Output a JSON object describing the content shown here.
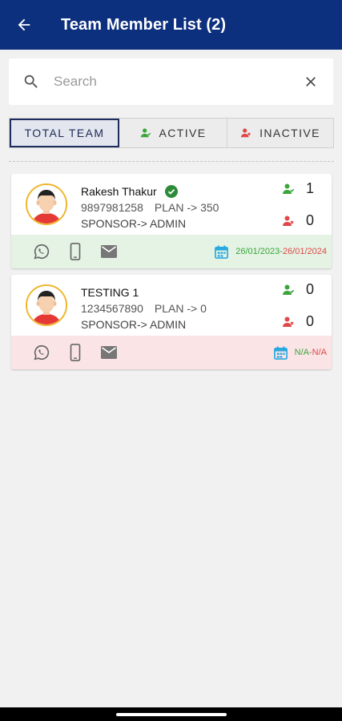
{
  "appbar": {
    "title": "Team Member List  (2)",
    "back_icon": "arrow-left-icon",
    "background": "#0c2f7e"
  },
  "search": {
    "placeholder": "Search",
    "value": ""
  },
  "tabs": [
    {
      "label": "TOTAL TEAM",
      "selected": true
    },
    {
      "label": "ACTIVE",
      "icon": "active-user-icon",
      "color": "#3aa53a"
    },
    {
      "label": "INACTIVE",
      "icon": "inactive-user-icon",
      "color": "#e04848"
    }
  ],
  "members": [
    {
      "name": "Rakesh Thakur",
      "verified": true,
      "phone": "9897981258",
      "plan": "PLAN -> 350",
      "sponsor": "SPONSOR-> ADMIN",
      "active_count": "1",
      "inactive_count": "0",
      "date_start": "26/01/2023",
      "date_sep": " - ",
      "date_end": "26/01/2024",
      "status": "active"
    },
    {
      "name": "TESTING 1",
      "verified": false,
      "phone": "1234567890",
      "plan": "PLAN -> 0",
      "sponsor": "SPONSOR-> ADMIN",
      "active_count": "0",
      "inactive_count": "0",
      "date_start": "N/A",
      "date_sep": " - ",
      "date_end": "N/A",
      "status": "inactive"
    }
  ],
  "colors": {
    "active": "#3aa53a",
    "inactive": "#e04848",
    "active_bg": "#e4f3e4",
    "inactive_bg": "#fbe4e6",
    "calendar": "#29a9e0"
  }
}
